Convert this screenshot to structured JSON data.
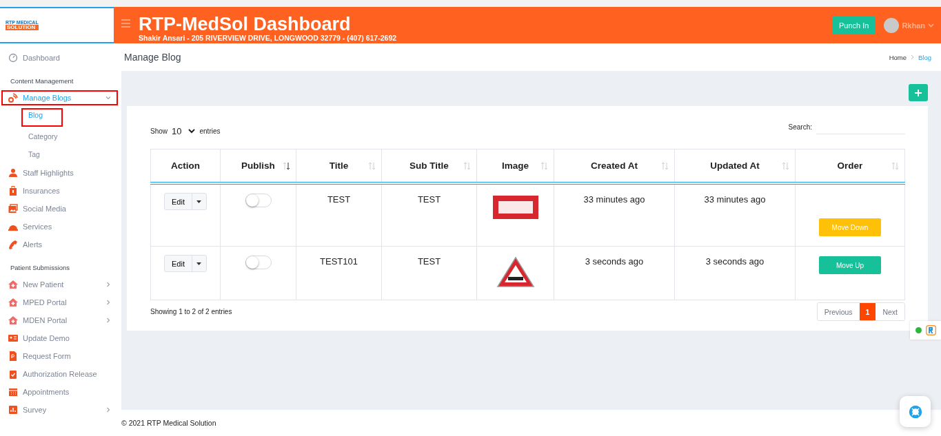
{
  "header": {
    "logo_top": "RTP MEDICAL",
    "logo_bottom": "SOLUTION",
    "title": "RTP-MedSol Dashboard",
    "subtitle": "Shakir Ansari - 205 RIVERVIEW DRIVE, LONGWOOD 32779 - (407) 617-2692",
    "punch_button": "Punch In",
    "user": "Rkhan"
  },
  "sidebar": {
    "sections": [
      {
        "items": [
          {
            "label": "Dashboard",
            "selected": false,
            "highlighted": false
          }
        ]
      },
      {
        "heading": "Content Management",
        "items": [
          {
            "label": "Manage Blogs",
            "selected": true,
            "highlighted": true,
            "expanded": true,
            "children": [
              {
                "label": "Blog",
                "selected": true,
                "highlighted": true
              },
              {
                "label": "Category",
                "selected": false,
                "highlighted": false
              },
              {
                "label": "Tag",
                "selected": false,
                "highlighted": false
              }
            ]
          },
          {
            "label": "Staff Highlights",
            "selected": false,
            "highlighted": false
          },
          {
            "label": "Insurances",
            "selected": false,
            "highlighted": false
          },
          {
            "label": "Social Media",
            "selected": false,
            "highlighted": false
          },
          {
            "label": "Services",
            "selected": false,
            "highlighted": false
          },
          {
            "label": "Alerts",
            "selected": false,
            "highlighted": false
          }
        ]
      },
      {
        "heading": "Patient Submissions",
        "items": [
          {
            "label": "New Patient",
            "selected": false,
            "highlighted": false,
            "expanded": false
          },
          {
            "label": "MPED Portal",
            "selected": false,
            "highlighted": false,
            "expanded": false
          },
          {
            "label": "MDEN Portal",
            "selected": false,
            "highlighted": false,
            "expanded": false
          },
          {
            "label": "Update Demo",
            "selected": false,
            "highlighted": false
          },
          {
            "label": "Request Form",
            "selected": false,
            "highlighted": false
          },
          {
            "label": "Authorization Release",
            "selected": false,
            "highlighted": false
          },
          {
            "label": "Appointments",
            "selected": false,
            "highlighted": false
          },
          {
            "label": "Survey",
            "selected": false,
            "highlighted": false,
            "expanded": false
          }
        ]
      }
    ]
  },
  "page": {
    "title": "Manage Blog",
    "breadcrumb": [
      {
        "label": "Home",
        "selected": false
      },
      {
        "label": "Blog",
        "selected": true
      }
    ]
  },
  "table_controls": {
    "show_label": "Show",
    "page_size": "10",
    "entries_label": "entries",
    "search_label": "Search:"
  },
  "table": {
    "columns": [
      {
        "label": "Action",
        "kind": "plain"
      },
      {
        "label": "Publish",
        "kind": "sorted"
      },
      {
        "label": "Title",
        "kind": "sortable"
      },
      {
        "label": "Sub Title",
        "kind": "sortable"
      },
      {
        "label": "Image",
        "kind": "sortable"
      },
      {
        "label": "Created At",
        "kind": "sortable"
      },
      {
        "label": "Updated At",
        "kind": "sortable"
      },
      {
        "label": "Order",
        "kind": "sortable"
      }
    ],
    "rows": [
      {
        "action": "Edit",
        "published": false,
        "title": "TEST",
        "sub_title": "TEST",
        "image": {
          "kind": "banner"
        },
        "created_at": "33 minutes ago",
        "updated_at": "33 minutes ago",
        "order": {
          "kind": "down",
          "label": "Move Down"
        }
      },
      {
        "action": "Edit",
        "published": false,
        "title": "TEST101",
        "sub_title": "TEST",
        "image": {
          "kind": "sign"
        },
        "created_at": "3 seconds ago",
        "updated_at": "3 seconds ago",
        "order": {
          "kind": "up",
          "label": "Move Up"
        }
      }
    ]
  },
  "table_info": "Showing 1 to 2 of 2 entries",
  "pagination": {
    "previous": "Previous",
    "pages": [
      {
        "label": "1",
        "selected": true
      }
    ],
    "next": "Next"
  },
  "footer": "© 2021 RTP Medical Solution"
}
